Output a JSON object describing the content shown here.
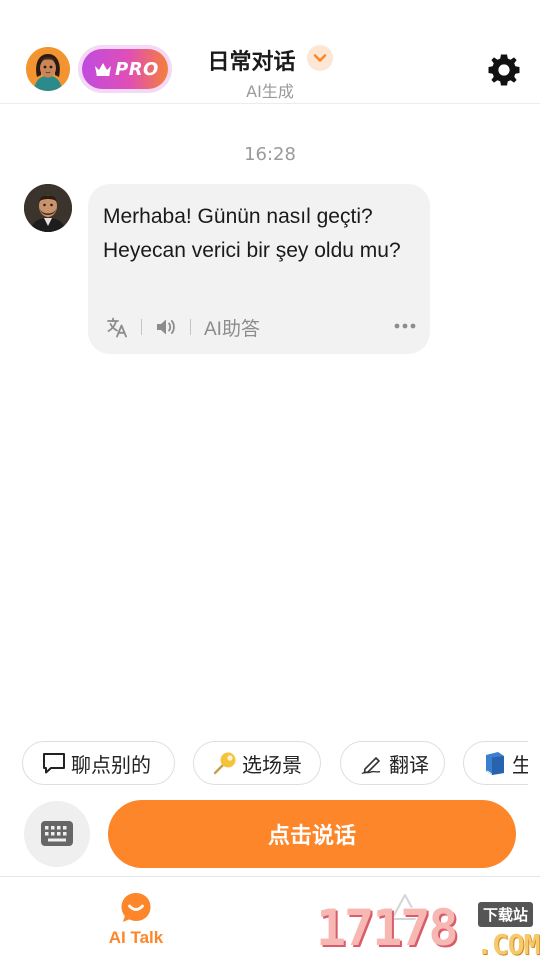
{
  "header": {
    "pro_label": "PRO",
    "title": "日常对话",
    "subtitle": "AI生成"
  },
  "chat": {
    "timestamp": "16:28",
    "messages": [
      {
        "sender": "bot",
        "text": "Merhaba! Günün nasıl geçti? Heyecan verici bir şey oldu mu?",
        "ai_answer_label": "AI助答"
      }
    ]
  },
  "chips": [
    {
      "icon": "speech-bubble-icon",
      "label": "聊点别的"
    },
    {
      "icon": "key-pin-icon",
      "label": "选场景"
    },
    {
      "icon": "pen-writing-icon",
      "label": "翻译"
    },
    {
      "icon": "blue-book-icon",
      "label": "生"
    }
  ],
  "input": {
    "speak_label": "点击说话"
  },
  "bottom_nav": {
    "items": [
      {
        "label": "AI Talk",
        "active": true,
        "color": "#fd862b"
      },
      {
        "label": "",
        "active": false
      }
    ]
  },
  "watermark": {
    "number": "17178",
    "tag": "下载站",
    "suffix": ".COM"
  },
  "colors": {
    "accent": "#fd862b",
    "pro_gradient_start": "#c04be0",
    "pro_gradient_end": "#f57f3a",
    "bubble_bg": "#f2f2f2"
  }
}
